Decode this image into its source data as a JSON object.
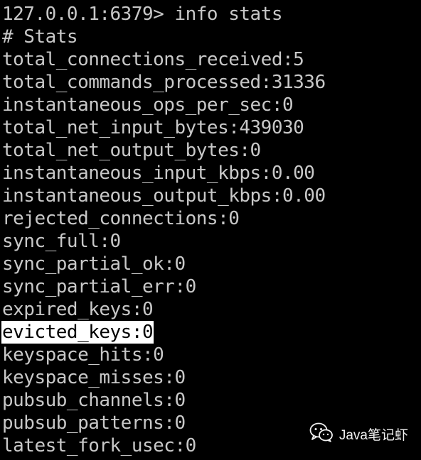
{
  "terminal": {
    "lines": [
      "127.0.0.1:6379> info stats",
      "# Stats",
      "total_connections_received:5",
      "total_commands_processed:31336",
      "instantaneous_ops_per_sec:0",
      "total_net_input_bytes:439030",
      "total_net_output_bytes:0",
      "instantaneous_input_kbps:0.00",
      "instantaneous_output_kbps:0.00",
      "rejected_connections:0",
      "sync_full:0",
      "sync_partial_ok:0",
      "sync_partial_err:0",
      "expired_keys:0",
      "evicted_keys:0",
      "keyspace_hits:0",
      "keyspace_misses:0",
      "pubsub_channels:0",
      "pubsub_patterns:0",
      "latest_fork_usec:0"
    ],
    "highlighted_line": "evicted_keys:0",
    "background_color": "#000000",
    "text_color": "#c8c8c8",
    "highlight_color": "#ffffff"
  },
  "watermark": {
    "icon": "wechat-icon",
    "text": "Java笔记虾"
  }
}
